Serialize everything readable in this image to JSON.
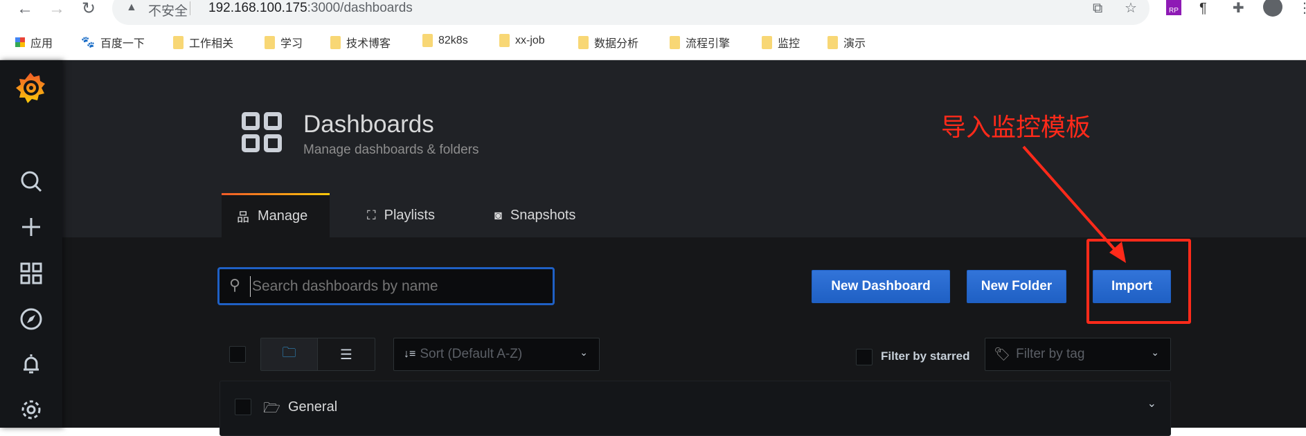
{
  "browser": {
    "insecure_label": "不安全",
    "url_host": "192.168.100.175",
    "url_rest": ":3000/dashboards",
    "bookmarks": [
      {
        "label": "应用",
        "icon": "apps-grid-icon"
      },
      {
        "label": "百度一下",
        "icon": "baidu-paw-icon"
      },
      {
        "label": "工作相关",
        "icon": "folder-icon"
      },
      {
        "label": "学习",
        "icon": "folder-icon"
      },
      {
        "label": "技术博客",
        "icon": "folder-icon"
      },
      {
        "label": "82k8s",
        "icon": "folder-icon"
      },
      {
        "label": "xx-job",
        "icon": "folder-icon"
      },
      {
        "label": "数据分析",
        "icon": "folder-icon"
      },
      {
        "label": "流程引擎",
        "icon": "folder-icon"
      },
      {
        "label": "监控",
        "icon": "folder-icon"
      },
      {
        "label": "演示",
        "icon": "folder-icon"
      }
    ],
    "extension_rp": "RP"
  },
  "header": {
    "title": "Dashboards",
    "subtitle": "Manage dashboards & folders"
  },
  "tabs": [
    {
      "label": "Manage",
      "active": true
    },
    {
      "label": "Playlists"
    },
    {
      "label": "Snapshots"
    }
  ],
  "search": {
    "placeholder": "Search dashboards by name",
    "value": ""
  },
  "actions": {
    "new_dashboard": "New Dashboard",
    "new_folder": "New Folder",
    "import": "Import"
  },
  "filters": {
    "sort": "Sort (Default A-Z)",
    "starred": "Filter by starred",
    "tag_placeholder": "Filter by tag"
  },
  "folders": [
    {
      "name": "General"
    }
  ],
  "annotation": {
    "text": "导入监控模板",
    "color": "#ff2a1a"
  },
  "colors": {
    "primary": "#3274d9",
    "brand_gradient": [
      "#f05a28",
      "#fbca0a"
    ]
  }
}
